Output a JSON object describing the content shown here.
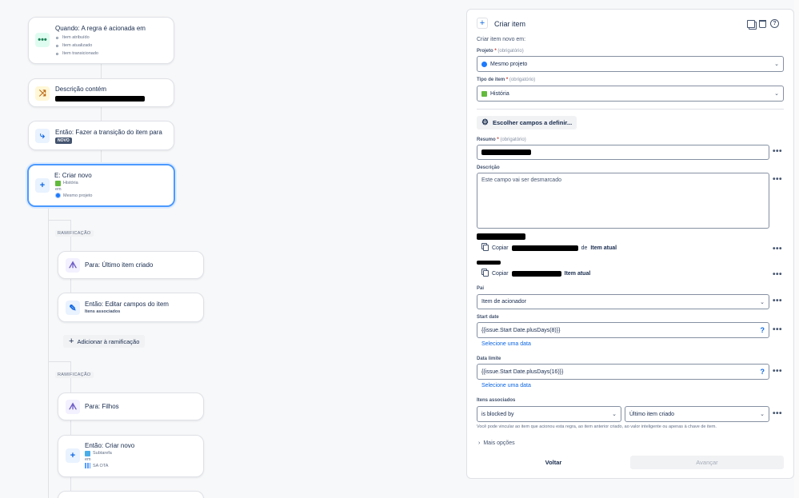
{
  "flow": {
    "trigger": {
      "title": "Quando: A regra é acionada em",
      "items": [
        "Item atribuído",
        "Item atualizado",
        "Item transicionado"
      ]
    },
    "condition": {
      "title": "Descrição contém"
    },
    "transition": {
      "title": "Então: Fazer a transição do item para",
      "badge": "NOVO"
    },
    "create": {
      "title": "E: Criar novo",
      "type": "História",
      "in": "em",
      "project": "Mesmo projeto"
    },
    "branch1": {
      "label": "RAMIFICAÇÃO",
      "for_title": "Para: Último item criado",
      "edit_title": "Então: Editar campos do item",
      "edit_sub": "Itens associados",
      "add_label": "Adicionar à ramificação"
    },
    "branch2": {
      "label": "RAMIFICAÇÃO",
      "for_title": "Para: Filhos",
      "create_title": "Então: Criar novo",
      "create_type": "Subtarefa",
      "create_in": "em",
      "create_project": "SA OTA"
    }
  },
  "panel": {
    "title": "Criar item",
    "subtitle": "Criar item novo em:",
    "project": {
      "label": "Projeto",
      "req": "*",
      "opt": "(obrigatório)",
      "value": "Mesmo projeto"
    },
    "issue_type": {
      "label": "Tipo de item",
      "req": "*",
      "opt": "(obrigatório)",
      "value": "História"
    },
    "choose_fields": "Escolher campos a definir...",
    "summary": {
      "label": "Resumo",
      "req": "*",
      "opt": "(obrigatório)"
    },
    "description": {
      "label": "Descrição",
      "value": "Este campo vai ser desmarcado"
    },
    "copy1": {
      "prefix": "Copiar",
      "middle": "de",
      "target": "Item atual"
    },
    "copy2": {
      "prefix": "Copiar",
      "target": "Item atual"
    },
    "parent": {
      "label": "Pai",
      "value": "Item de acionador"
    },
    "start_date": {
      "label": "Start date",
      "value": "{{issue.Start Date.plusDays(8)}}",
      "link": "Selecione uma data"
    },
    "due_date": {
      "label": "Data limite",
      "value": "{{issue.Start Date.plusDays(16)}}",
      "link": "Selecione uma data"
    },
    "linked": {
      "label": "Itens associados",
      "relation": "is blocked by",
      "target": "Último item criado",
      "help": "Você pode vincular ao item que acionou esta regra, ao item anterior criado, ao valor inteligente ou apenas à chave de item."
    },
    "more_options": "Mais opções",
    "back": "Voltar",
    "next": "Avançar"
  },
  "colors": {
    "accent": "#0c66e4",
    "selected_border": "#4c9aff",
    "story_green": "#63ba3c"
  }
}
